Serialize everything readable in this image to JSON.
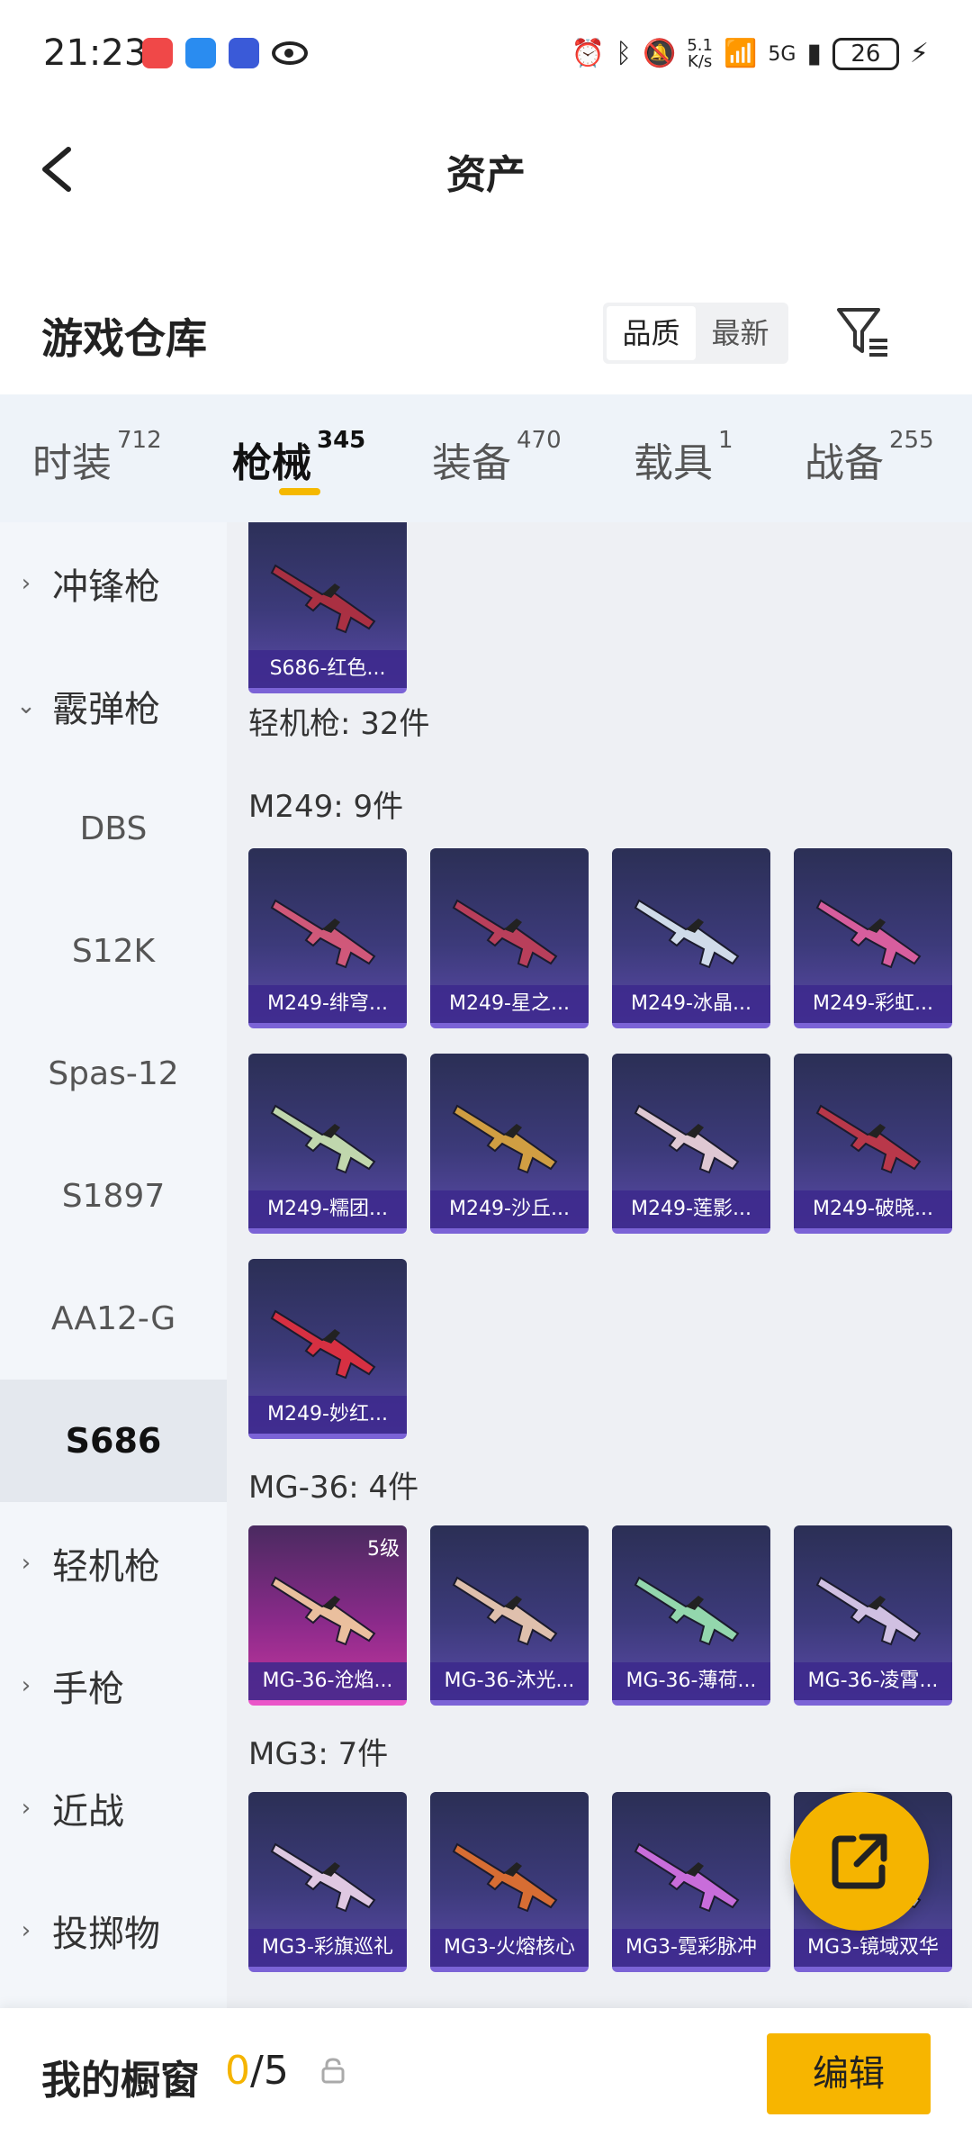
{
  "status_bar": {
    "time": "21:23",
    "net_speed_value": "5.1",
    "net_speed_unit": "K/s",
    "signal": "5G",
    "battery": "26"
  },
  "header": {
    "title": "资产"
  },
  "warehouse": {
    "title": "游戏仓库",
    "sort_options": [
      "品质",
      "最新"
    ],
    "active_sort": "品质"
  },
  "tabs": [
    {
      "label": "时装",
      "count": "712"
    },
    {
      "label": "枪械",
      "count": "345"
    },
    {
      "label": "装备",
      "count": "470"
    },
    {
      "label": "载具",
      "count": "1"
    },
    {
      "label": "战备",
      "count": "255"
    }
  ],
  "active_tab": "枪械",
  "sidebar": {
    "items": [
      {
        "label": "冲锋枪",
        "chevron": "›"
      },
      {
        "label": "霰弹枪",
        "chevron": "⌄"
      },
      {
        "label": "DBS"
      },
      {
        "label": "S12K"
      },
      {
        "label": "Spas-12"
      },
      {
        "label": "S1897"
      },
      {
        "label": "AA12-G"
      },
      {
        "label": "S686"
      },
      {
        "label": "轻机枪",
        "chevron": "›"
      },
      {
        "label": "手枪",
        "chevron": "›"
      },
      {
        "label": "近战",
        "chevron": "›"
      },
      {
        "label": "投掷物",
        "chevron": "›"
      }
    ],
    "selected": "S686"
  },
  "content": {
    "top_card": {
      "name": "S686-红色...",
      "color": "#b03040"
    },
    "section_label": "轻机枪: 32件",
    "groups": [
      {
        "label": "M249: 9件",
        "cards": [
          {
            "name": "M249-绯穹...",
            "color": "#d85a7a"
          },
          {
            "name": "M249-星之...",
            "color": "#c0405a"
          },
          {
            "name": "M249-冰晶...",
            "color": "#d8e4f0"
          },
          {
            "name": "M249-彩虹...",
            "color": "#e060a0"
          },
          {
            "name": "M249-糯团...",
            "color": "#c8e0b0"
          },
          {
            "name": "M249-沙丘...",
            "color": "#d8a440"
          },
          {
            "name": "M249-莲影...",
            "color": "#e8d0d8"
          },
          {
            "name": "M249-破晓...",
            "color": "#c03848"
          },
          {
            "name": "M249-妙红...",
            "color": "#e03040"
          }
        ]
      },
      {
        "label": "MG-36: 4件",
        "cards": [
          {
            "name": "MG-36-沧焰...",
            "color": "#f0c8a0",
            "level": "5级"
          },
          {
            "name": "MG-36-沐光...",
            "color": "#e8c8b0"
          },
          {
            "name": "MG-36-薄荷...",
            "color": "#98e0b0"
          },
          {
            "name": "MG-36-凌霄...",
            "color": "#d8c8e8"
          }
        ]
      },
      {
        "label": "MG3: 7件",
        "cards": [
          {
            "name": "MG3-彩旗巡礼",
            "color": "#e8d0e8"
          },
          {
            "name": "MG3-火熔核心",
            "color": "#e07030"
          },
          {
            "name": "MG3-霓彩脉冲",
            "color": "#d070e0"
          },
          {
            "name": "MG3-镜域双华",
            "color": "#c0c0d0"
          }
        ]
      }
    ]
  },
  "bottom_bar": {
    "label": "我的橱窗",
    "current": "0",
    "total": "/5",
    "edit_label": "编辑"
  },
  "colors": {
    "accent": "#f5b400",
    "tab_bg": "#eef3f9",
    "content_bg": "#eef0f4",
    "card_bottom": "#7b63d6",
    "rare_card": "#c6369e"
  },
  "icons": {
    "back": "back-arrow-icon",
    "filter": "filter-icon",
    "fab": "share-external-icon",
    "lock": "lock-icon"
  }
}
